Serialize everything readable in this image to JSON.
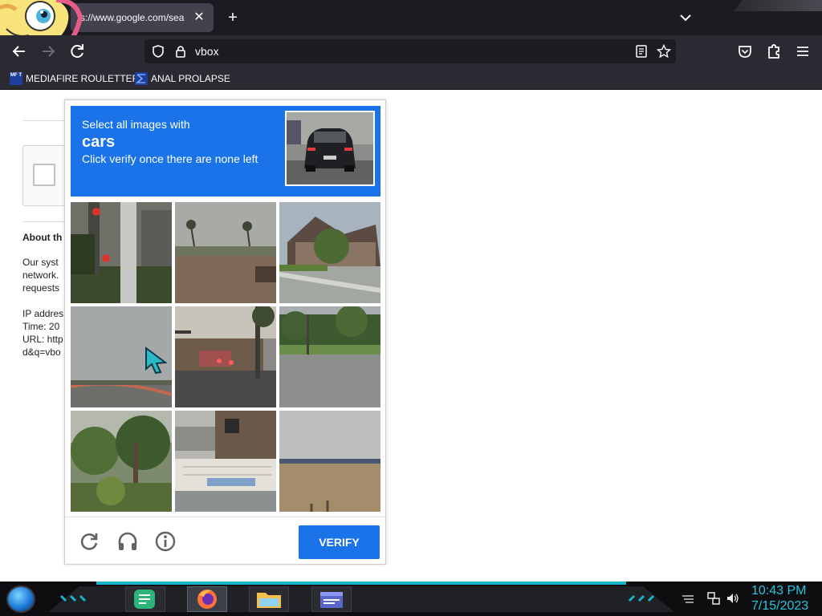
{
  "browser": {
    "tab": {
      "title": "s://www.google.com/search",
      "close": "✕"
    },
    "new_tab": "+",
    "url": "vbox",
    "bookmarks": [
      {
        "icon_text": "MF T",
        "label": "MEDIAFIRE ROULETTER"
      },
      {
        "label": "ANAL PROLAPSE"
      }
    ]
  },
  "page": {
    "about_heading": "About th",
    "paragraph": [
      "Our syst",
      "network.",
      "requests"
    ],
    "info": [
      "IP addres",
      "Time: 20",
      "URL: http",
      "d&q=vbo"
    ]
  },
  "captcha": {
    "line1": "Select all images with",
    "target": "cars",
    "line3": "Click verify once there are none left",
    "verify_label": "VERIFY",
    "tiles": [
      "traffic-light-pole",
      "road-field-palms",
      "house-corner",
      "noisy-road-sky",
      "street-traffic",
      "trees-road",
      "bushes-trees",
      "house-porch",
      "field-horizon"
    ]
  },
  "taskbar": {
    "time": "10:43 PM",
    "date": "7/15/2023",
    "apps": [
      "notes-app",
      "firefox",
      "file-explorer",
      "window-app"
    ]
  },
  "colors": {
    "accent": "#1a73e8",
    "chrome_dark": "#1c1b22",
    "chrome": "#2b2a33",
    "clock": "#28c3e0"
  }
}
